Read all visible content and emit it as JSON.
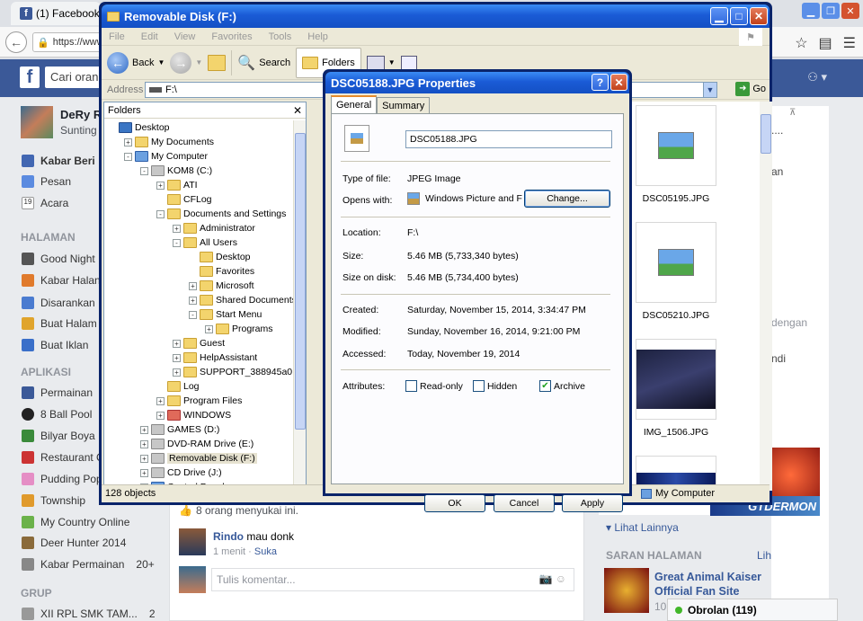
{
  "browser": {
    "tab_title": "(1) Facebook",
    "url_text": "https://www",
    "window_controls": [
      "minimize-icon",
      "maximize-icon",
      "close-icon"
    ]
  },
  "facebook": {
    "logo": "f",
    "search_placeholder": "Cari oran",
    "profile": {
      "name": "DeRy R",
      "sub": "Sunting"
    },
    "menu_main": [
      "Kabar Beri",
      "Pesan",
      "Acara"
    ],
    "halaman_header": "HALAMAN",
    "halaman_items": [
      "Good Night",
      "Kabar Halan",
      "Disarankan",
      "Buat Halam",
      "Buat Iklan"
    ],
    "aplikasi_header": "APLIKASI",
    "aplikasi_items": [
      "Permainan",
      "8 Ball Pool",
      "Bilyar Boya",
      "Restaurant C",
      "Pudding Pop",
      "Township",
      "My Country Online",
      "Deer Hunter 2014",
      "Kabar Permainan"
    ],
    "kabar_permainan_count": "20+",
    "grup_header": "GRUP",
    "grup_items": [
      "XII RPL SMK TAM..."
    ],
    "grup_count": "2",
    "feed": {
      "likes": "8 orang menyukai ini.",
      "comment_author": "Rindo",
      "comment_text": "mau donk",
      "comment_time": "1 menit",
      "comment_like": "Suka",
      "comment_placeholder": "Tulis komentar..."
    },
    "right": {
      "frag1": "an",
      "frag2": "dengan",
      "frag3": "ndi",
      "frag_dots": "....",
      "see_more": "Lihat Lainnya",
      "saran_header": "SARAN HALAMAN",
      "lihat_semua": "Lihat Semua",
      "page_name": "Great Animal Kaiser Official Fan Site",
      "page_count": "10",
      "chat": "Obrolan (119)",
      "banner_text": "GTDERMON"
    }
  },
  "explorer": {
    "title": "Removable Disk (F:)",
    "menu": [
      "File",
      "Edit",
      "View",
      "Favorites",
      "Tools",
      "Help"
    ],
    "toolbar": {
      "back": "Back",
      "search": "Search",
      "folders": "Folders"
    },
    "address_label": "Address",
    "address_value": "F:\\",
    "go_label": "Go",
    "folders_title": "Folders",
    "tree": [
      {
        "label": "Desktop",
        "indent": 0,
        "icon": "desktop-icon",
        "expander": ""
      },
      {
        "label": "My Documents",
        "indent": 1,
        "icon": "folder-icon",
        "expander": "+"
      },
      {
        "label": "My Computer",
        "indent": 1,
        "icon": "computer-icon",
        "expander": "-"
      },
      {
        "label": "KOM8 (C:)",
        "indent": 2,
        "icon": "drive-icon",
        "expander": "-"
      },
      {
        "label": "ATI",
        "indent": 3,
        "icon": "folder-icon",
        "expander": "+"
      },
      {
        "label": "CFLog",
        "indent": 3,
        "icon": "folder-icon",
        "expander": ""
      },
      {
        "label": "Documents and Settings",
        "indent": 3,
        "icon": "folder-icon",
        "expander": "-"
      },
      {
        "label": "Administrator",
        "indent": 4,
        "icon": "folder-icon",
        "expander": "+"
      },
      {
        "label": "All Users",
        "indent": 4,
        "icon": "folder-icon",
        "expander": "-"
      },
      {
        "label": "Desktop",
        "indent": 5,
        "icon": "folder-icon",
        "expander": ""
      },
      {
        "label": "Favorites",
        "indent": 5,
        "icon": "folder-icon",
        "expander": ""
      },
      {
        "label": "Microsoft",
        "indent": 5,
        "icon": "folder-icon",
        "expander": "+"
      },
      {
        "label": "Shared Documents",
        "indent": 5,
        "icon": "folder-icon",
        "expander": "+"
      },
      {
        "label": "Start Menu",
        "indent": 5,
        "icon": "folder-icon",
        "expander": "-"
      },
      {
        "label": "Programs",
        "indent": 6,
        "icon": "folder-icon",
        "expander": "+"
      },
      {
        "label": "Guest",
        "indent": 4,
        "icon": "folder-icon",
        "expander": "+"
      },
      {
        "label": "HelpAssistant",
        "indent": 4,
        "icon": "folder-icon",
        "expander": "+"
      },
      {
        "label": "SUPPORT_388945a0",
        "indent": 4,
        "icon": "folder-icon",
        "expander": "+"
      },
      {
        "label": "Log",
        "indent": 3,
        "icon": "folder-icon",
        "expander": ""
      },
      {
        "label": "Program Files",
        "indent": 3,
        "icon": "folder-icon",
        "expander": "+"
      },
      {
        "label": "WINDOWS",
        "indent": 3,
        "icon": "windows-folder-icon",
        "expander": "+"
      },
      {
        "label": "GAMES (D:)",
        "indent": 2,
        "icon": "drive-icon",
        "expander": "+"
      },
      {
        "label": "DVD-RAM Drive (E:)",
        "indent": 2,
        "icon": "drive-icon",
        "expander": "+"
      },
      {
        "label": "Removable Disk (F:)",
        "indent": 2,
        "icon": "removable-drive-icon",
        "expander": "+",
        "selected": true
      },
      {
        "label": "CD Drive (J:)",
        "indent": 2,
        "icon": "cd-drive-icon",
        "expander": "+"
      },
      {
        "label": "Control Panel",
        "indent": 2,
        "icon": "control-panel-icon",
        "expander": "+"
      }
    ],
    "files": [
      "DSC05195.JPG",
      "DSC05210.JPG",
      "IMG_1506.JPG"
    ],
    "status_count": "128 objects",
    "status_location": "My Computer"
  },
  "dialog": {
    "title": "DSC05188.JPG Properties",
    "tabs": [
      "General",
      "Summary"
    ],
    "filename": "DSC05188.JPG",
    "type_label": "Type of file:",
    "type_value": "JPEG Image",
    "opens_label": "Opens with:",
    "opens_value": "Windows Picture and F",
    "change_button": "Change...",
    "location_label": "Location:",
    "location_value": "F:\\",
    "size_label": "Size:",
    "size_value": "5.46 MB (5,733,340 bytes)",
    "size_disk_label": "Size on disk:",
    "size_disk_value": "5.46 MB (5,734,400 bytes)",
    "created_label": "Created:",
    "created_value": "Saturday, November 15, 2014, 3:34:47 PM",
    "modified_label": "Modified:",
    "modified_value": "Sunday, November 16, 2014, 9:21:00 PM",
    "accessed_label": "Accessed:",
    "accessed_value": "Today, November 19, 2014",
    "attributes_label": "Attributes:",
    "readonly_label": "Read-only",
    "readonly_checked": false,
    "hidden_label": "Hidden",
    "hidden_checked": false,
    "archive_label": "Archive",
    "archive_checked": true,
    "ok": "OK",
    "cancel": "Cancel",
    "apply": "Apply"
  }
}
